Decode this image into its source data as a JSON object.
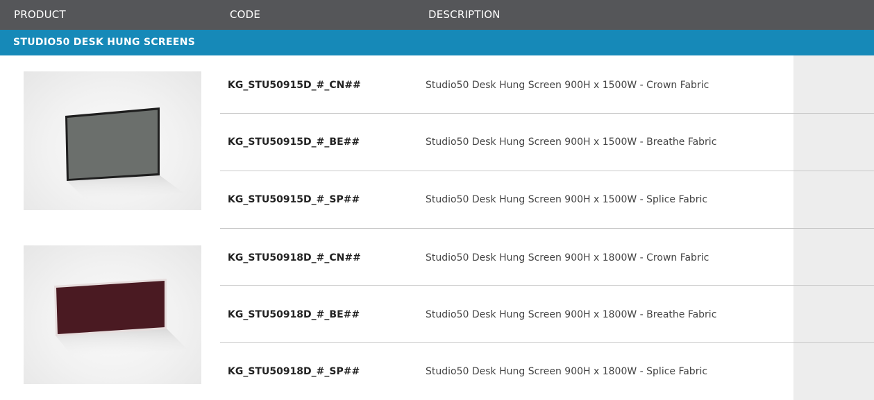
{
  "header": {
    "product_label": "PRODUCT",
    "code_label": "CODE",
    "description_label": "DESCRIPTION"
  },
  "section": {
    "title": "STUDIO50 DESK HUNG SCREENS"
  },
  "products": [
    {
      "image_icon": "grey-screen-panel-icon",
      "panel_color": "#6b6f6c",
      "rows": [
        {
          "code": "KG_STU50915D_#_CN##",
          "description": "Studio50 Desk Hung Screen 900H x 1500W - Crown Fabric"
        },
        {
          "code": "KG_STU50915D_#_BE##",
          "description": "Studio50 Desk Hung Screen 900H x 1500W - Breathe Fabric"
        },
        {
          "code": "KG_STU50915D_#_SP##",
          "description": "Studio50 Desk Hung Screen 900H x 1500W - Splice Fabric"
        }
      ]
    },
    {
      "image_icon": "burgundy-screen-panel-icon",
      "panel_color": "#4a1a22",
      "rows": [
        {
          "code": "KG_STU50918D_#_CN##",
          "description": "Studio50 Desk Hung Screen 900H x 1800W - Crown Fabric"
        },
        {
          "code": "KG_STU50918D_#_BE##",
          "description": "Studio50 Desk Hung Screen 900H x 1800W - Breathe Fabric"
        },
        {
          "code": "KG_STU50918D_#_SP##",
          "description": "Studio50 Desk Hung Screen 900H x 1800W - Splice Fabric"
        }
      ]
    }
  ],
  "colors": {
    "header_bg": "#555659",
    "section_bg": "#1689b8",
    "side_column_bg": "#ededed"
  }
}
